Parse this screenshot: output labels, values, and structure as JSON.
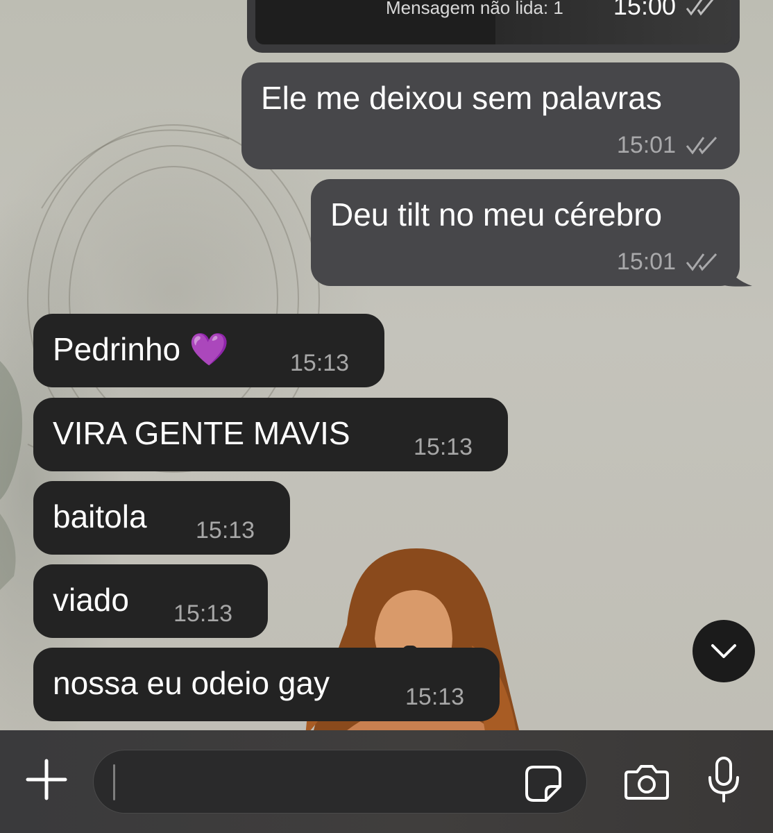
{
  "theme": {
    "outgoing_bubble": "#47474a",
    "incoming_bubble": "#232323",
    "input_bar": "#3a3a3c",
    "heart_color": "#a64dff"
  },
  "quoted_message": {
    "preview_text": "Mensagem não lida: 1",
    "time": "15:00",
    "status_icon": "double-check-icon"
  },
  "messages": [
    {
      "direction": "outgoing",
      "text": "Ele me deixou sem palavras",
      "time": "15:01",
      "status_icon": "double-check-icon"
    },
    {
      "direction": "outgoing",
      "text": "Deu tilt no meu cérebro",
      "time": "15:01",
      "status_icon": "double-check-icon"
    },
    {
      "direction": "incoming",
      "text": "Pedrinho 💜",
      "time": "15:13"
    },
    {
      "direction": "incoming",
      "text": "VIRA GENTE MAVIS",
      "time": "15:13"
    },
    {
      "direction": "incoming",
      "text": "baitola",
      "time": "15:13"
    },
    {
      "direction": "incoming",
      "text": "viado",
      "time": "15:13"
    },
    {
      "direction": "incoming",
      "text": "nossa eu odeio gay",
      "time": "15:13"
    }
  ],
  "input_bar": {
    "attach_icon": "plus-icon",
    "message_placeholder": "",
    "sticker_icon": "sticker-icon",
    "camera_icon": "camera-icon",
    "mic_icon": "microphone-icon"
  },
  "scroll_down_icon": "chevron-down-icon"
}
